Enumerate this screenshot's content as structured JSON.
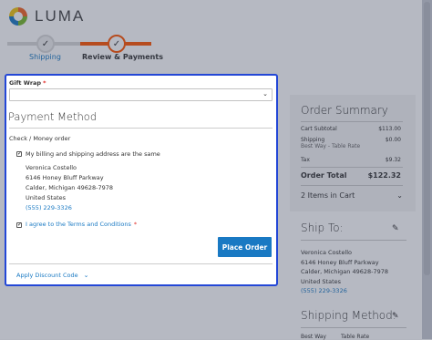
{
  "logo": {
    "text": "LUMA"
  },
  "progress": {
    "steps": [
      {
        "label": "Shipping",
        "state": "complete"
      },
      {
        "label": "Review & Payments",
        "state": "active"
      }
    ]
  },
  "gift_wrap": {
    "label": "Gift Wrap",
    "required_mark": "*",
    "value": ""
  },
  "payment": {
    "title": "Payment Method",
    "method": "Check / Money order",
    "same_address_label": "My billing and shipping address are the same",
    "same_address_checked": true,
    "address": [
      "Veronica Costello",
      "6146 Honey Bluff Parkway",
      "Calder, Michigan 49628-7978",
      "United States"
    ],
    "phone": "(555) 229-3326",
    "terms_label": "I agree to the Terms and Conditions",
    "terms_required_mark": "*",
    "terms_checked": true,
    "place_order": "Place Order",
    "discount_label": "Apply Discount Code"
  },
  "summary": {
    "title": "Order Summary",
    "cart_subtotal_label": "Cart Subtotal",
    "cart_subtotal_value": "$113.00",
    "shipping_label": "Shipping",
    "shipping_method": "Best Way - Table Rate",
    "shipping_value": "$0.00",
    "tax_label": "Tax",
    "tax_value": "$9.32",
    "total_label": "Order Total",
    "total_value": "$122.32",
    "items_label": "2 Items in Cart"
  },
  "ship_to": {
    "title": "Ship To:",
    "address": [
      "Veronica Costello",
      "6146 Honey Bluff Parkway",
      "Calder, Michigan 49628-7978",
      "United States"
    ],
    "phone": "(555) 229-3326"
  },
  "shipping_method": {
    "title": "Shipping Method:",
    "partial_left": "Best Way",
    "partial_right": "Table Rate"
  },
  "colors": {
    "accent_blue": "#1979c3",
    "progress_orange": "#ff5501",
    "focus_border": "#2347d6",
    "required_red": "#e02b27"
  }
}
